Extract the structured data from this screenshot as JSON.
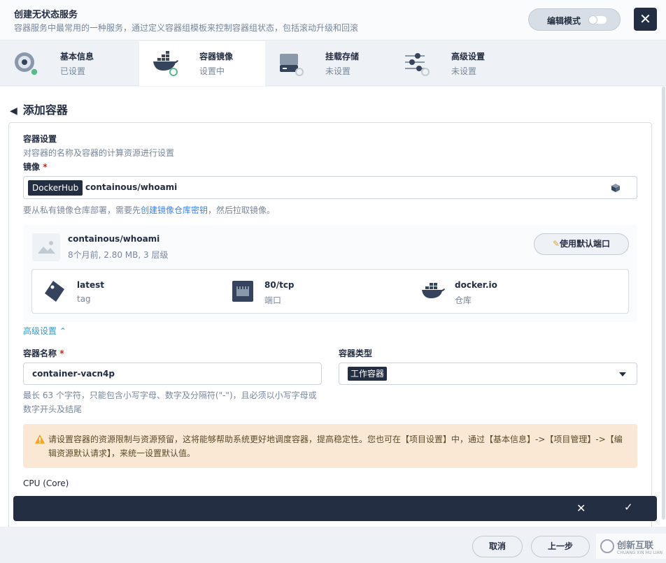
{
  "header": {
    "title": "创建无状态服务",
    "description": "容器服务中最常用的一种服务，通过定义容器组模板来控制容器组状态，包括滚动升级和回滚",
    "edit_mode_label": "编辑模式"
  },
  "steps": [
    {
      "name": "基本信息",
      "status": "已设置"
    },
    {
      "name": "容器镜像",
      "status": "设置中"
    },
    {
      "name": "挂载存储",
      "status": "未设置"
    },
    {
      "name": "高级设置",
      "status": "未设置"
    }
  ],
  "page": {
    "back_title": "添加容器"
  },
  "container_settings": {
    "title": "容器设置",
    "description": "对容器的名称及容器的计算资源进行设置",
    "image_label": "镜像",
    "required_mark": "*",
    "registry_tag": "DockerHub",
    "image_value": "containous/whoami",
    "hint_prefix": "要从私有镜像仓库部署，需要先",
    "hint_link": "创建镜像仓库密钥",
    "hint_suffix": "，然后拉取镜像。"
  },
  "image_info": {
    "name": "containous/whoami",
    "meta": "8个月前, 2.80 MB, 3 层级",
    "use_default_port_button": "使用默认端口",
    "tag_value": "latest",
    "tag_key": "tag",
    "port_value": "80/tcp",
    "port_key": "端口",
    "registry_value": "docker.io",
    "registry_key": "仓库"
  },
  "advanced_toggle": "高级设置",
  "container_name": {
    "label": "容器名称",
    "value": "container-vacn4p",
    "hint": "最长 63 个字符，只能包含小写字母、数字及分隔符(\"-\")，且必须以小写字母或数字开头及结尾"
  },
  "container_type": {
    "label": "容器类型",
    "value": "工作容器"
  },
  "warning": {
    "text": "请设置容器的资源限制与资源预留，这将能够帮助系统更好地调度容器，提高稳定性。您也可在【项目设置】中，通过【基本信息】->【项目管理】->【编辑资源默认请求】，来统一设置默认值。"
  },
  "cpu_label": "CPU (Core)",
  "footer": {
    "cancel": "取消",
    "previous": "上一步",
    "watermark": "创新互联",
    "watermark_sub": "CHUANG XIN HU LIAN"
  },
  "colors": {
    "dark": "#242e42",
    "accent_green": "#55bc8a",
    "link": "#329dce",
    "warning_bg": "#fae7d4"
  }
}
